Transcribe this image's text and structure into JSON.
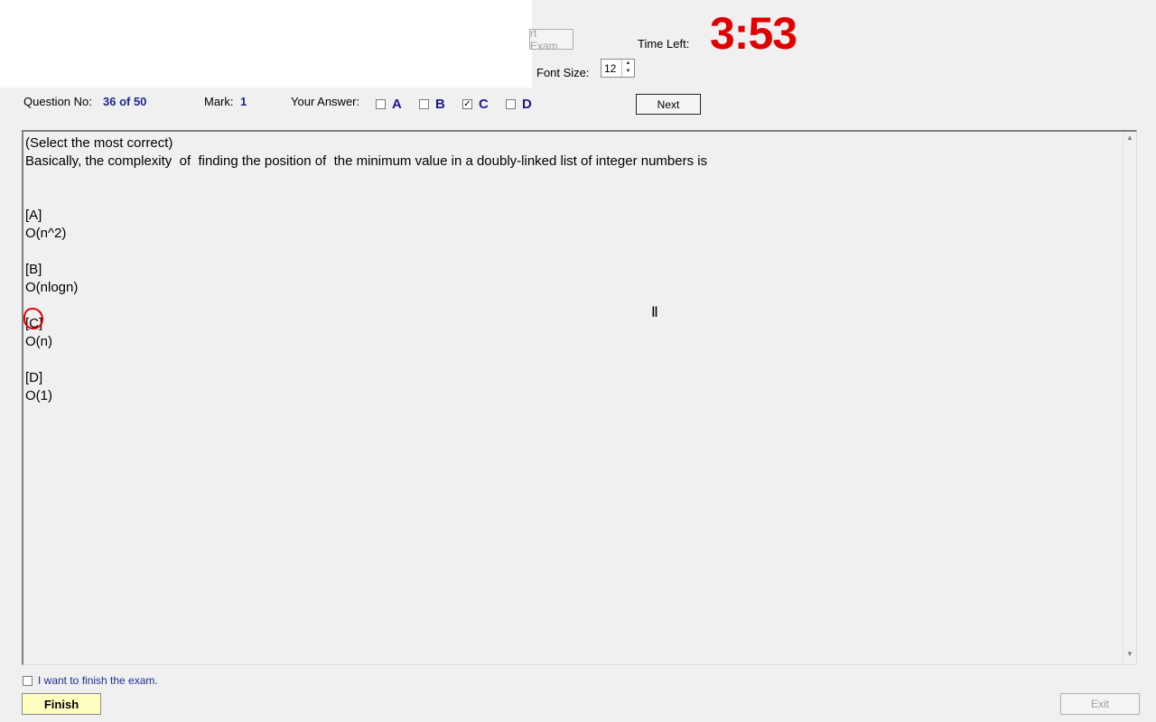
{
  "header": {
    "start_exam_label": "rt Exam",
    "time_left_label": "Time Left:",
    "timer": "3:53",
    "font_size_label": "Font Size:",
    "font_size_value": "12"
  },
  "question_bar": {
    "question_no_label": "Question No:",
    "question_no_value": "36 of 50",
    "mark_label": "Mark:",
    "mark_value": "1",
    "your_answer_label": "Your Answer:",
    "options": [
      {
        "letter": "A",
        "checked": false
      },
      {
        "letter": "B",
        "checked": false
      },
      {
        "letter": "C",
        "checked": true
      },
      {
        "letter": "D",
        "checked": false
      }
    ],
    "next_label": "Next"
  },
  "question": {
    "lines": [
      "(Select the most correct)",
      "Basically, the complexity  of  finding the position of  the minimum value in a doubly-linked list of integer numbers is",
      "",
      "",
      "[A]",
      "O(n^2)",
      "",
      "[B]",
      "O(nlogn)",
      "",
      "[C]",
      "O(n)",
      "",
      "[D]",
      "O(1)"
    ]
  },
  "footer": {
    "finish_checkbox_label": "I want to finish the exam.",
    "finish_label": "Finish",
    "exit_label": "Exit"
  },
  "colors": {
    "timer": "#e00000",
    "answer_letters": "#1c1c8c",
    "finish_button": "#ffffc0"
  }
}
